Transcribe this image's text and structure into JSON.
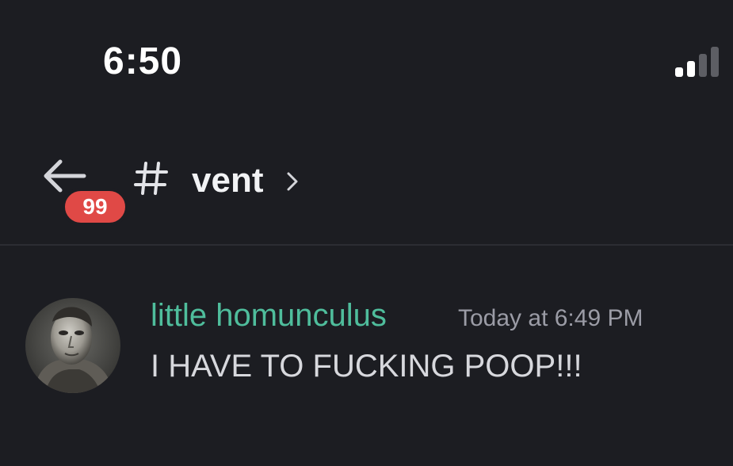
{
  "status_bar": {
    "time": "6:50",
    "signal_icon": "cellular-signal-icon"
  },
  "header": {
    "back_icon": "arrow-left-icon",
    "unread_badge": "99",
    "channel_icon": "hash-icon",
    "channel_name": "vent",
    "chevron_icon": "chevron-right-icon"
  },
  "message": {
    "author": "little homunculus",
    "author_color": "#4fbd9c",
    "timestamp": "Today at 6:49 PM",
    "text": "I HAVE TO FUCKING POOP!!!"
  },
  "colors": {
    "background": "#1c1d22",
    "badge": "#e04946"
  }
}
